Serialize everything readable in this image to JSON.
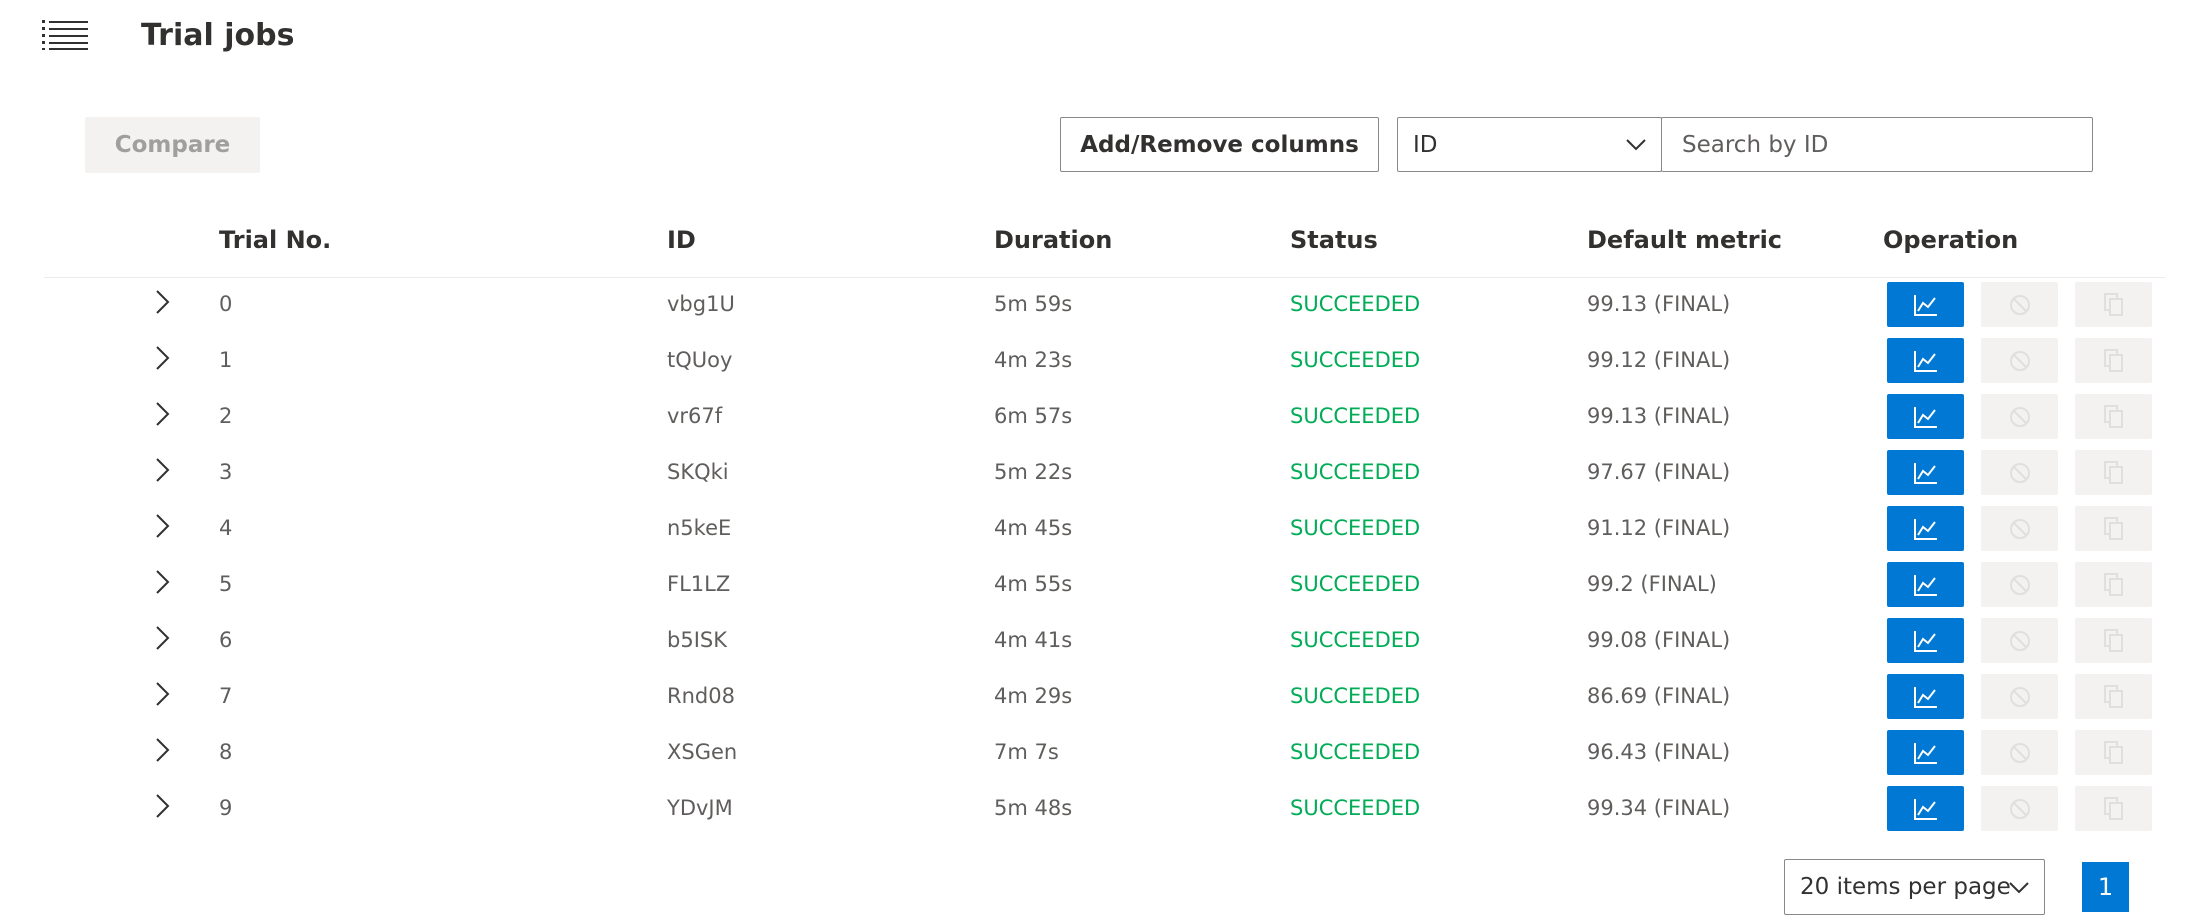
{
  "header": {
    "title": "Trial jobs"
  },
  "toolbar": {
    "compare_label": "Compare",
    "columns_label": "Add/Remove columns",
    "search_field_selected": "ID",
    "search_placeholder": "Search by ID"
  },
  "table": {
    "columns": [
      "Trial No.",
      "ID",
      "Duration",
      "Status",
      "Default metric",
      "Operation"
    ],
    "rows": [
      {
        "trial_no": "0",
        "id": "vbg1U",
        "duration": "5m 59s",
        "status": "SUCCEEDED",
        "metric": "99.13 (FINAL)"
      },
      {
        "trial_no": "1",
        "id": "tQUoy",
        "duration": "4m 23s",
        "status": "SUCCEEDED",
        "metric": "99.12 (FINAL)"
      },
      {
        "trial_no": "2",
        "id": "vr67f",
        "duration": "6m 57s",
        "status": "SUCCEEDED",
        "metric": "99.13 (FINAL)"
      },
      {
        "trial_no": "3",
        "id": "SKQki",
        "duration": "5m 22s",
        "status": "SUCCEEDED",
        "metric": "97.67 (FINAL)"
      },
      {
        "trial_no": "4",
        "id": "n5keE",
        "duration": "4m 45s",
        "status": "SUCCEEDED",
        "metric": "91.12 (FINAL)"
      },
      {
        "trial_no": "5",
        "id": "FL1LZ",
        "duration": "4m 55s",
        "status": "SUCCEEDED",
        "metric": "99.2 (FINAL)"
      },
      {
        "trial_no": "6",
        "id": "b5ISK",
        "duration": "4m 41s",
        "status": "SUCCEEDED",
        "metric": "99.08 (FINAL)"
      },
      {
        "trial_no": "7",
        "id": "Rnd08",
        "duration": "4m 29s",
        "status": "SUCCEEDED",
        "metric": "86.69 (FINAL)"
      },
      {
        "trial_no": "8",
        "id": "XSGen",
        "duration": "7m 7s",
        "status": "SUCCEEDED",
        "metric": "96.43 (FINAL)"
      },
      {
        "trial_no": "9",
        "id": "YDvJM",
        "duration": "5m 48s",
        "status": "SUCCEEDED",
        "metric": "99.34 (FINAL)"
      }
    ]
  },
  "pagination": {
    "page_size_label": "20 items per page",
    "current_page": "1"
  },
  "icons": {
    "menu": "menu-list-icon",
    "expand": "chevron-right-icon",
    "chart": "line-chart-icon",
    "kill": "blocked-icon",
    "copy": "copy-icon",
    "dropdown": "chevron-down-icon"
  },
  "colors": {
    "accent": "#0078d4",
    "success": "#00ad56",
    "disabled_bg": "#f3f2f1"
  }
}
